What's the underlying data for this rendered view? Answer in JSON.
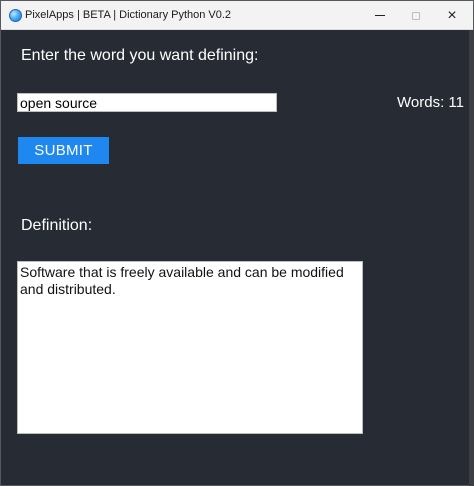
{
  "window": {
    "title": "PixelApps | BETA | Dictionary Python V0.2",
    "icon": "app-globe-icon",
    "controls": {
      "minimize": "minimize-icon",
      "maximize": "maximize-icon",
      "close": "×"
    }
  },
  "form": {
    "prompt_label": "Enter the word you want defining:",
    "input_value": "open source",
    "word_count": "Words: 11",
    "submit_label": "SUBMIT"
  },
  "definition": {
    "label": "Definition:",
    "text": "Software that is freely available and can be modified and distributed."
  },
  "colors": {
    "background": "#272b33",
    "accent_button": "#1e88f0",
    "titlebar": "#f3f3f3"
  }
}
